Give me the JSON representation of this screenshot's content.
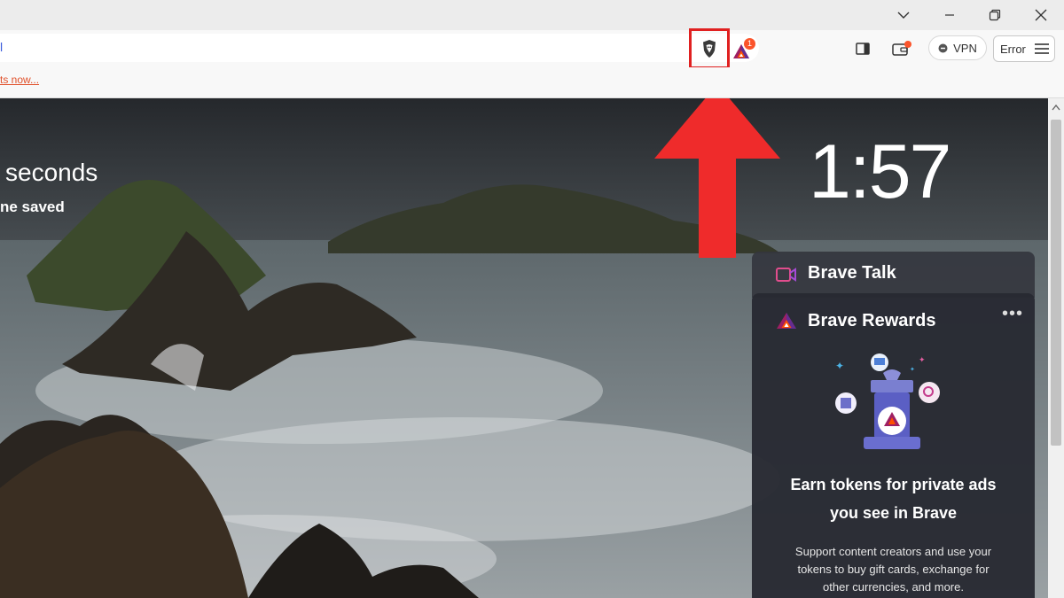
{
  "browser": {
    "url_text": "l",
    "vpn_label": "VPN",
    "error_label": "Error",
    "rewards_badge": "1",
    "infobar_link": "ts now..."
  },
  "ntp": {
    "partial_text_1": "seconds",
    "partial_text_2": "ne saved",
    "clock": "1:57"
  },
  "widgets": {
    "talk_title": "Brave Talk",
    "rewards_title": "Brave Rewards",
    "rewards_headline_1": "Earn tokens for private ads",
    "rewards_headline_2": "you see in Brave",
    "rewards_desc_1": "Support content creators and use your",
    "rewards_desc_2": "tokens to buy gift cards, exchange for",
    "rewards_desc_3": "other currencies, and more."
  },
  "icons": {
    "chevron": "chevron-down-icon",
    "minimize": "minimize-icon",
    "restore": "restore-icon",
    "close": "close-icon",
    "shields": "brave-shield-icon",
    "rewards": "bat-triangle-icon",
    "sidebar": "sidebar-icon",
    "wallet": "wallet-icon",
    "menu": "hamburger-menu-icon"
  },
  "colors": {
    "highlight_red": "#e02020",
    "brave_orange": "#fb542b",
    "link_orange": "#e0502a"
  }
}
